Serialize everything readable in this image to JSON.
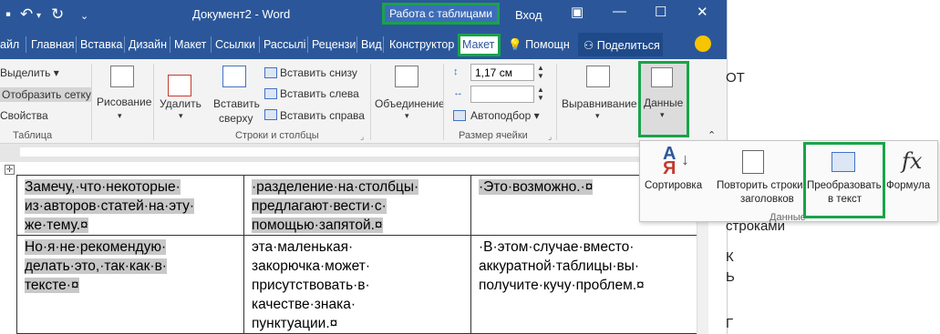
{
  "titlebar": {
    "doc_title": "Документ2  -  Word",
    "table_tools": "Работа с таблицами",
    "signin": "Вход"
  },
  "tabs": {
    "items": [
      "айл",
      "Главная",
      "Вставка",
      "Дизайн",
      "Макет",
      "Ссылки",
      "Рассылі",
      "Рецензи",
      "Вид",
      "Конструктор"
    ],
    "active": "Макет",
    "tell_me": "Помощн",
    "share": "Поделиться"
  },
  "ribbon": {
    "table_group": {
      "select": "Выделить",
      "gridlines": "Отобразить сетку",
      "properties": "Свойства",
      "label": "Таблица"
    },
    "draw": {
      "label": "Рисование"
    },
    "delete": {
      "label": "Удалить"
    },
    "insert_above": {
      "line1": "Вставить",
      "line2": "сверху"
    },
    "rows_cols": {
      "insert_below": "Вставить снизу",
      "insert_left": "Вставить слева",
      "insert_right": "Вставить справа",
      "label": "Строки и столбцы"
    },
    "merge": {
      "label": "Объединение"
    },
    "cell_size": {
      "height_value": "1,17 см",
      "autofit": "Автоподбор",
      "label": "Размер ячейки"
    },
    "alignment": {
      "label": "Выравнивание"
    },
    "data": {
      "label": "Данные"
    }
  },
  "data_dropdown": {
    "sort": "Сортировка",
    "repeat_header_1": "Повторить строки",
    "repeat_header_2": "заголовков",
    "convert_1": "Преобразовать",
    "convert_2": "в текст",
    "formula": "Формула",
    "group_label": "Данные"
  },
  "table": {
    "rows": [
      [
        [
          "Замечу,·что·некоторые·",
          "из·авторов·статей·на·эту·",
          "же·тему.¤"
        ],
        [
          "·разделение·на·столбцы·",
          "предлагают·вести·с·",
          "помощью·запятой.¤"
        ],
        [
          "·Это·возможно.·¤"
        ]
      ],
      [
        [
          "Но·я·не·рекомендую·",
          "делать·это,·так·как·в·",
          "тексте·¤"
        ],
        [
          "эта·маленькая·",
          "закорючка·может·",
          "присутствовать·в·",
          "качестве·знака·",
          "пунктуации.¤"
        ],
        [
          "·В·этом·случае·вместо·",
          "аккуратной·таблицы·вы·",
          "получите·кучу·проблем.¤"
        ]
      ]
    ],
    "end_mark": "¤"
  },
  "right_window": {
    "fragment_1": "ОТ",
    "fragment_2": "строками",
    "fragment_3": "К",
    "fragment_4": "Ь",
    "fragment_5": "Г"
  },
  "colors": {
    "word_blue": "#2b579a",
    "highlight_green": "#19a34a",
    "selection_gray": "#c8c8c8"
  }
}
